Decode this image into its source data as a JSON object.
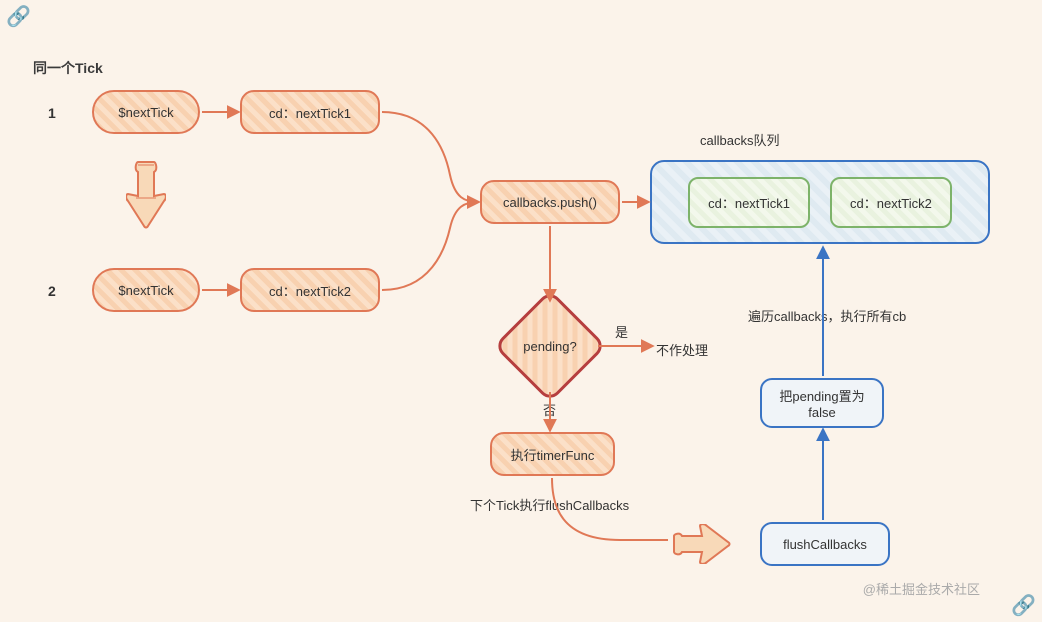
{
  "title": "同一个Tick",
  "rows": {
    "r1": "1",
    "r2": "2"
  },
  "nextTick": {
    "label": "$nextTick"
  },
  "cd1": {
    "label": "cd：nextTick1"
  },
  "cd2": {
    "label": "cd：nextTick2"
  },
  "push": {
    "label": "callbacks.push()"
  },
  "pending": {
    "label": "pending?",
    "yes": "是",
    "no": "否",
    "noop": "不作处理"
  },
  "timerFunc": {
    "label": "执行timerFunc"
  },
  "nextTickNote": "下个Tick执行flushCallbacks",
  "queue": {
    "title": "callbacks队列",
    "items": {
      "i1": "cd：nextTick1",
      "i2": "cd：nextTick2"
    }
  },
  "flush": {
    "label": "flushCallbacks"
  },
  "setFalse": {
    "label": "把pending置为false"
  },
  "iterateNote": "遍历callbacks，执行所有cb",
  "watermark": "@稀土掘金技术社区",
  "colors": {
    "orange": "#e07856",
    "blue": "#3a74c4",
    "green": "#7db36a",
    "darkred": "#b63e3e"
  }
}
